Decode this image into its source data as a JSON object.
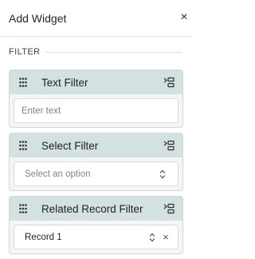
{
  "header": {
    "title": "Add Widget",
    "close_glyph": "×",
    "close_icon": "close-icon"
  },
  "section": {
    "label": "FILTER"
  },
  "widgets": [
    {
      "title": "Text Filter",
      "control": "text-input",
      "placeholder": "Enter text",
      "value": ""
    },
    {
      "title": "Select Filter",
      "control": "select",
      "placeholder": "Select an option",
      "value": ""
    },
    {
      "title": "Related Record Filter",
      "control": "select-clearable",
      "placeholder": "",
      "value": "Record 1",
      "clear_glyph": "×"
    }
  ],
  "icons": {
    "drag": "drag-handle-icon",
    "add": "add-to-layout-icon",
    "select": "chevron-up-down-icon",
    "clear": "clear-icon"
  },
  "colors": {
    "card_header": "#d3e1e0",
    "card_body": "#f4f6f6",
    "card_border": "#cfd6d6",
    "text": "#1f2328",
    "placeholder": "#7d848a"
  }
}
